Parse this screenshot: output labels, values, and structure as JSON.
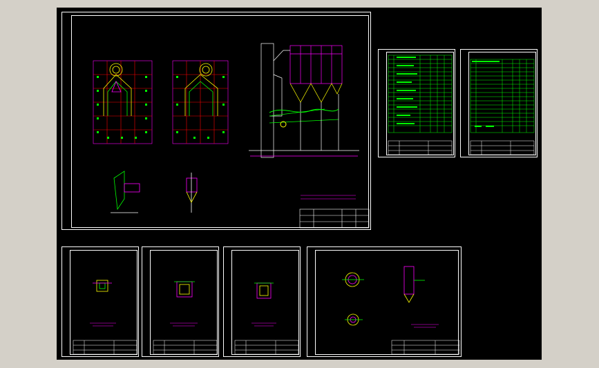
{
  "app": {
    "window_title": "",
    "model_space_background": "#000000",
    "colors": {
      "frame": "#ffffff",
      "dimension": "#ff00ff",
      "structure": "#ffff00",
      "table": "#00ff00",
      "annotation": "#00ffff",
      "hatch": "#ff0000"
    }
  },
  "sheets": [
    {
      "id": "main-arrangement",
      "kind": "arrangement",
      "has_title_block": true
    },
    {
      "id": "equipment-list-1",
      "kind": "table",
      "has_title_block": true
    },
    {
      "id": "equipment-list-2",
      "kind": "table",
      "has_title_block": true
    },
    {
      "id": "detail-1",
      "kind": "detail",
      "has_title_block": true
    },
    {
      "id": "detail-2",
      "kind": "detail",
      "has_title_block": true
    },
    {
      "id": "detail-3",
      "kind": "detail",
      "has_title_block": true
    },
    {
      "id": "detail-4",
      "kind": "detail",
      "has_title_block": true
    }
  ]
}
